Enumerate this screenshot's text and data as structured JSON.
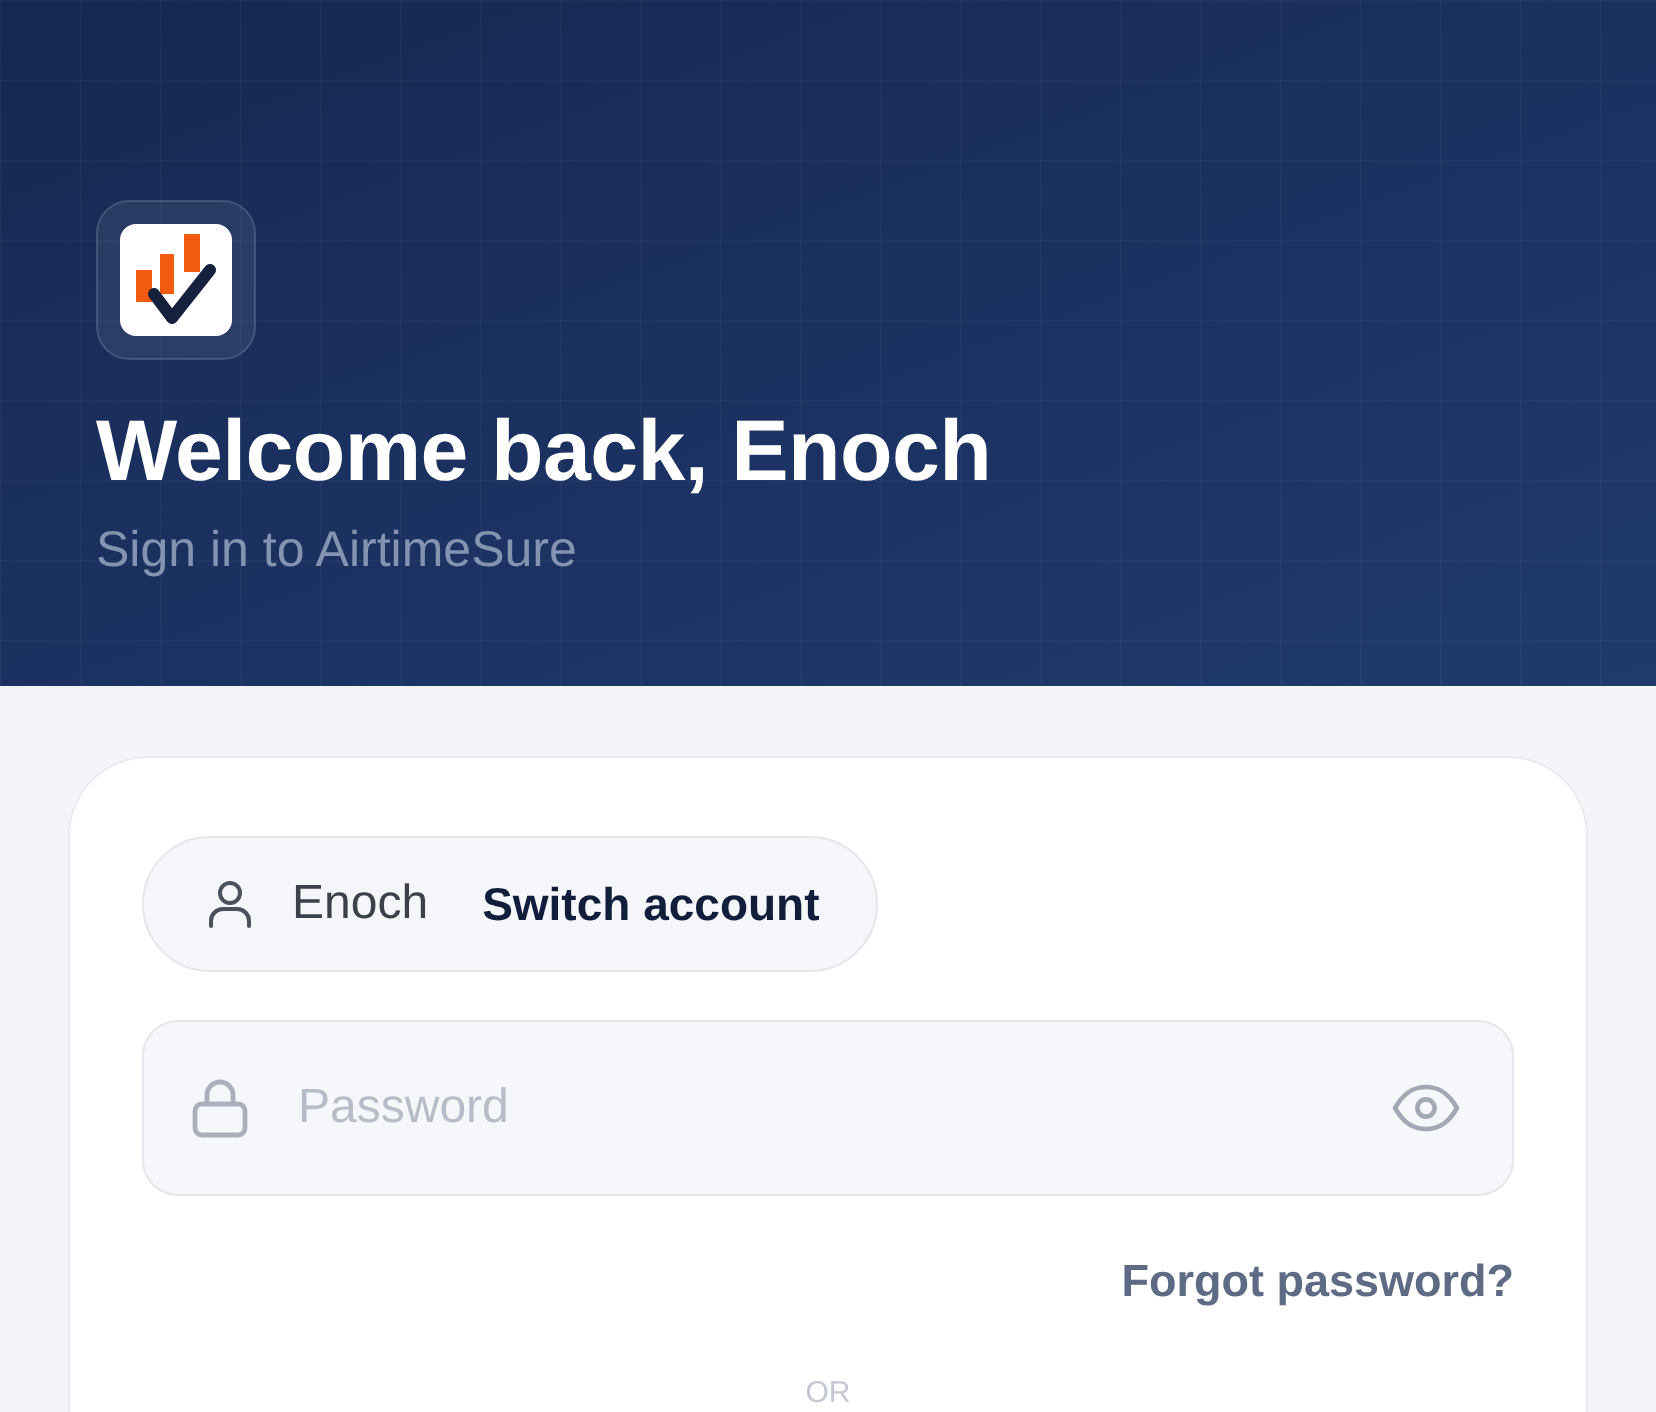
{
  "header": {
    "title": "Welcome back, Enoch",
    "subtitle": "Sign in to AirtimeSure"
  },
  "account": {
    "name": "Enoch",
    "action": "Switch account"
  },
  "password_field": {
    "placeholder": "Password"
  },
  "forgot_password": "Forgot password?",
  "divider": "OR"
}
